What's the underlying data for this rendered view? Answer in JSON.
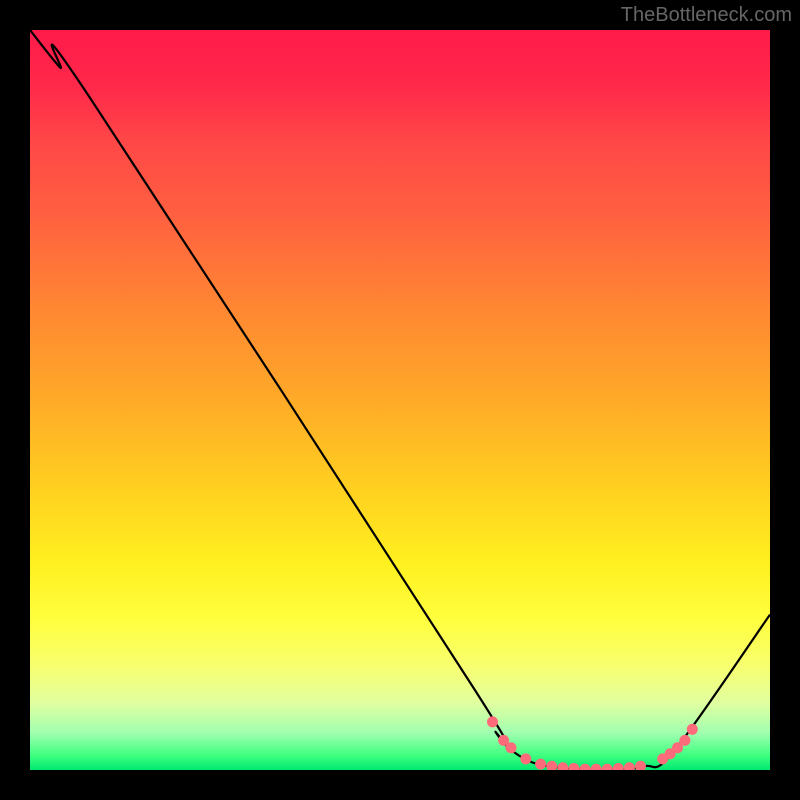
{
  "watermark": "TheBottleneck.com",
  "chart_data": {
    "type": "line",
    "title": "",
    "xlabel": "",
    "ylabel": "",
    "xlim": [
      0,
      100
    ],
    "ylim": [
      0,
      100
    ],
    "curve": [
      {
        "x": 0,
        "y": 100
      },
      {
        "x": 4,
        "y": 95
      },
      {
        "x": 8,
        "y": 91
      },
      {
        "x": 60,
        "y": 11
      },
      {
        "x": 63,
        "y": 5
      },
      {
        "x": 66,
        "y": 2
      },
      {
        "x": 70,
        "y": 0.5
      },
      {
        "x": 78,
        "y": 0
      },
      {
        "x": 83,
        "y": 0.5
      },
      {
        "x": 87,
        "y": 2.5
      },
      {
        "x": 100,
        "y": 21
      }
    ],
    "markers": [
      {
        "x": 62.5,
        "y": 6.5
      },
      {
        "x": 64,
        "y": 4
      },
      {
        "x": 65,
        "y": 3
      },
      {
        "x": 67,
        "y": 1.5
      },
      {
        "x": 69,
        "y": 0.8
      },
      {
        "x": 70.5,
        "y": 0.5
      },
      {
        "x": 72,
        "y": 0.3
      },
      {
        "x": 73.5,
        "y": 0.2
      },
      {
        "x": 75,
        "y": 0.1
      },
      {
        "x": 76.5,
        "y": 0.1
      },
      {
        "x": 78,
        "y": 0.1
      },
      {
        "x": 79.5,
        "y": 0.2
      },
      {
        "x": 81,
        "y": 0.3
      },
      {
        "x": 82.5,
        "y": 0.5
      },
      {
        "x": 85.5,
        "y": 1.5
      },
      {
        "x": 86.5,
        "y": 2.2
      },
      {
        "x": 87.5,
        "y": 3
      },
      {
        "x": 88.5,
        "y": 4
      },
      {
        "x": 89.5,
        "y": 5.5
      }
    ],
    "marker_color": "#ff6b7a",
    "curve_color": "#000000",
    "gradient_stops": [
      {
        "pos": 0,
        "color": "#ff1a4a"
      },
      {
        "pos": 50,
        "color": "#ffaa28"
      },
      {
        "pos": 80,
        "color": "#ffff40"
      },
      {
        "pos": 100,
        "color": "#00e870"
      }
    ]
  }
}
